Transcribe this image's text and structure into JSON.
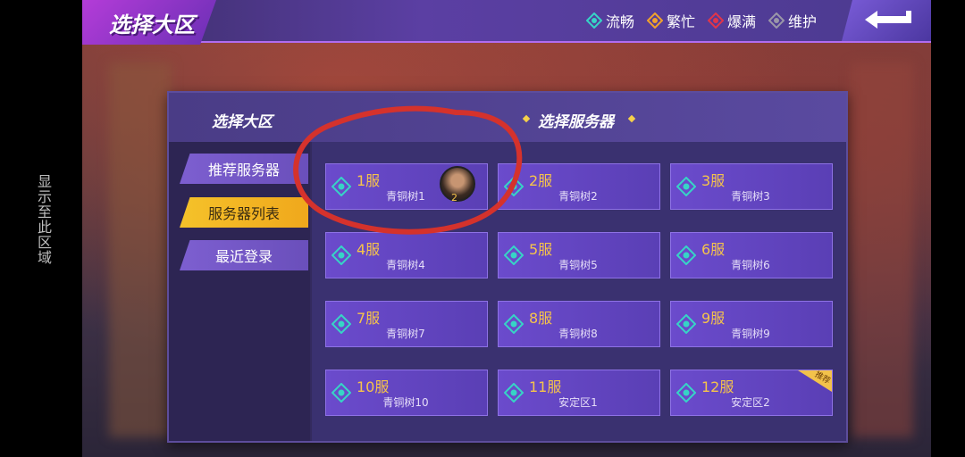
{
  "side_note": "显示至此区域",
  "header": {
    "title": "选择大区",
    "legend": [
      {
        "label": "流畅",
        "color": "#37d4c6"
      },
      {
        "label": "繁忙",
        "color": "#f0a22c"
      },
      {
        "label": "爆满",
        "color": "#e0354a"
      },
      {
        "label": "维护",
        "color": "#9a97a8"
      }
    ],
    "back_icon": "back-arrow-icon"
  },
  "panel": {
    "title": "选择大区",
    "server_heading": "选择服务器",
    "tabs": [
      {
        "label": "推荐服务器",
        "active": false
      },
      {
        "label": "服务器列表",
        "active": true
      },
      {
        "label": "最近登录",
        "active": false
      }
    ],
    "servers": [
      {
        "name": "1服",
        "sub": "青铜树1",
        "has_avatar": true,
        "avatar_level": "2"
      },
      {
        "name": "2服",
        "sub": "青铜树2"
      },
      {
        "name": "3服",
        "sub": "青铜树3"
      },
      {
        "name": "4服",
        "sub": "青铜树4"
      },
      {
        "name": "5服",
        "sub": "青铜树5"
      },
      {
        "name": "6服",
        "sub": "青铜树6"
      },
      {
        "name": "7服",
        "sub": "青铜树7"
      },
      {
        "name": "8服",
        "sub": "青铜树8"
      },
      {
        "name": "9服",
        "sub": "青铜树9"
      },
      {
        "name": "10服",
        "sub": "青铜树10"
      },
      {
        "name": "11服",
        "sub": "安定区1"
      },
      {
        "name": "12服",
        "sub": "安定区2",
        "badge": "推荐"
      }
    ]
  }
}
